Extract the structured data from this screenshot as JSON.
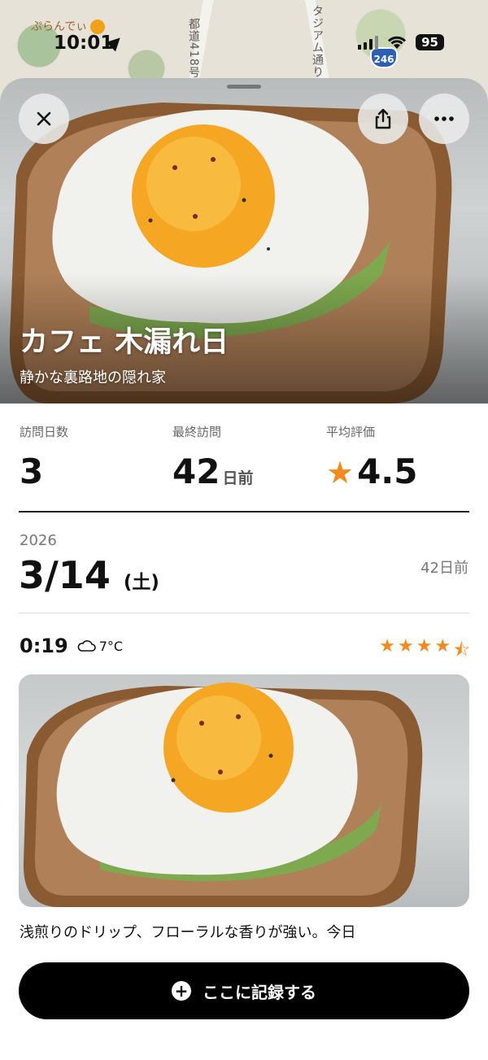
{
  "status_bar": {
    "map_shop_label": "ぷらんでぃ",
    "map_road_label_1": "都道418号",
    "map_road_label_2": "タジアム通り",
    "route_number": "246",
    "time": "10:01",
    "battery": "95"
  },
  "hero": {
    "title": "カフェ 木漏れ日",
    "subtitle": "静かな裏路地の隠れ家",
    "close_icon": "close-icon",
    "share_icon": "share-icon",
    "more_icon": "more-icon"
  },
  "stats": [
    {
      "label": "訪問日数",
      "value": "3",
      "unit": ""
    },
    {
      "label": "最終訪問",
      "value": "42",
      "unit": "日前"
    },
    {
      "label": "平均評価",
      "value": "4.5",
      "unit": ""
    }
  ],
  "visit": {
    "year": "2026",
    "date": "3/14",
    "weekday": "(土)",
    "days_ago": "42日前",
    "time": "0:19",
    "weather_icon": "cloud-icon",
    "temperature": "7°C",
    "rating": 4.5,
    "note": "浅煎りのドリップ、フローラルな香りが強い。今日"
  },
  "actions": {
    "record_label": "ここに記録する"
  },
  "colors": {
    "accent": "#f28a1f",
    "button": "#000000"
  }
}
